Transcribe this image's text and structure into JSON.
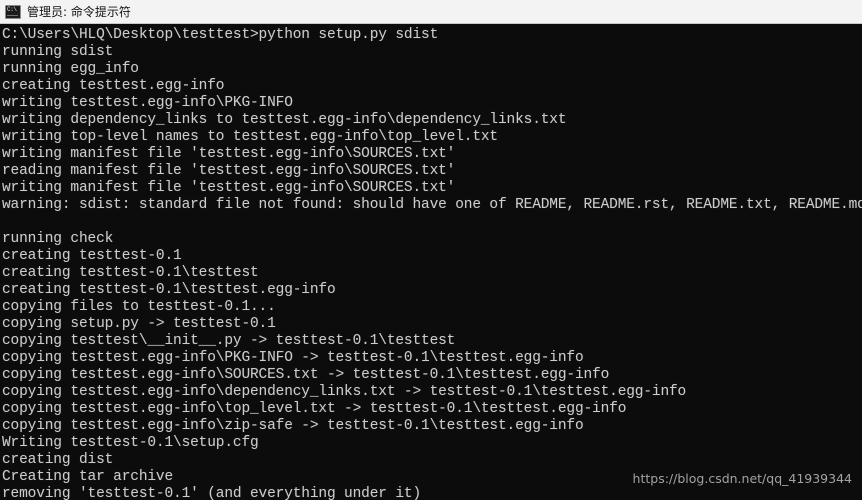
{
  "titlebar": {
    "icon": "command-prompt-icon",
    "icon_glyph": "C:\\",
    "title": "管理员: 命令提示符"
  },
  "console": {
    "background_color": "#0c0c0c",
    "text_color": "#cccccc",
    "lines": [
      "C:\\Users\\HLQ\\Desktop\\testtest>python setup.py sdist",
      "running sdist",
      "running egg_info",
      "creating testtest.egg-info",
      "writing testtest.egg-info\\PKG-INFO",
      "writing dependency_links to testtest.egg-info\\dependency_links.txt",
      "writing top-level names to testtest.egg-info\\top_level.txt",
      "writing manifest file 'testtest.egg-info\\SOURCES.txt'",
      "reading manifest file 'testtest.egg-info\\SOURCES.txt'",
      "writing manifest file 'testtest.egg-info\\SOURCES.txt'",
      "warning: sdist: standard file not found: should have one of README, README.rst, README.txt, README.md",
      "",
      "running check",
      "creating testtest-0.1",
      "creating testtest-0.1\\testtest",
      "creating testtest-0.1\\testtest.egg-info",
      "copying files to testtest-0.1...",
      "copying setup.py -> testtest-0.1",
      "copying testtest\\__init__.py -> testtest-0.1\\testtest",
      "copying testtest.egg-info\\PKG-INFO -> testtest-0.1\\testtest.egg-info",
      "copying testtest.egg-info\\SOURCES.txt -> testtest-0.1\\testtest.egg-info",
      "copying testtest.egg-info\\dependency_links.txt -> testtest-0.1\\testtest.egg-info",
      "copying testtest.egg-info\\top_level.txt -> testtest-0.1\\testtest.egg-info",
      "copying testtest.egg-info\\zip-safe -> testtest-0.1\\testtest.egg-info",
      "Writing testtest-0.1\\setup.cfg",
      "creating dist",
      "Creating tar archive",
      "removing 'testtest-0.1' (and everything under it)"
    ]
  },
  "watermark": {
    "text": "https://blog.csdn.net/qq_41939344"
  }
}
